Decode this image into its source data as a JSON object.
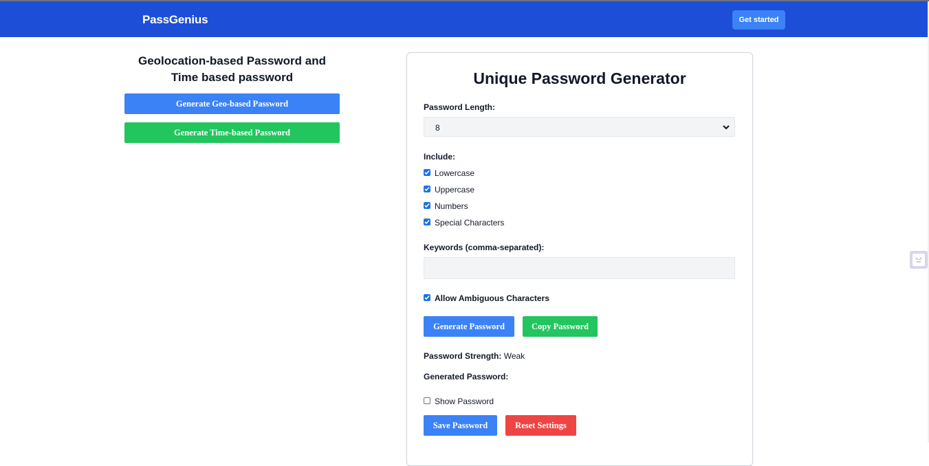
{
  "navbar": {
    "brand": "PassGenius",
    "cta_label": "Get started"
  },
  "left_panel": {
    "title": "Geolocation-based Password and Time based password",
    "geo_button": "Generate Geo-based Password",
    "time_button": "Generate Time-based Password"
  },
  "generator": {
    "title": "Unique Password Generator",
    "length_label": "Password Length:",
    "length_value": "8",
    "include_label": "Include:",
    "options": [
      {
        "label": "Lowercase",
        "checked": true
      },
      {
        "label": "Uppercase",
        "checked": true
      },
      {
        "label": "Numbers",
        "checked": true
      },
      {
        "label": "Special Characters",
        "checked": true
      }
    ],
    "keywords_label": "Keywords (comma-separated):",
    "keywords_value": "",
    "ambiguous_label": "Allow Ambiguous Characters",
    "ambiguous_checked": true,
    "generate_button": "Generate Password",
    "copy_button": "Copy Password",
    "strength_label": "Password Strength:",
    "strength_value": "Weak",
    "generated_label": "Generated Password:",
    "generated_value": "",
    "show_password_label": "Show Password",
    "show_password_checked": false,
    "save_button": "Save Password",
    "reset_button": "Reset Settings"
  },
  "colors": {
    "navbar": "#1d4ed8",
    "primary": "#3b82f6",
    "success": "#22c55e",
    "danger": "#ef4444",
    "checkbox": "#1a73e8"
  },
  "icons": {
    "select_chevron": "chevron-down-icon",
    "checkbox_check": "checkmark-icon",
    "side_widget": "extension-widget-icon"
  }
}
